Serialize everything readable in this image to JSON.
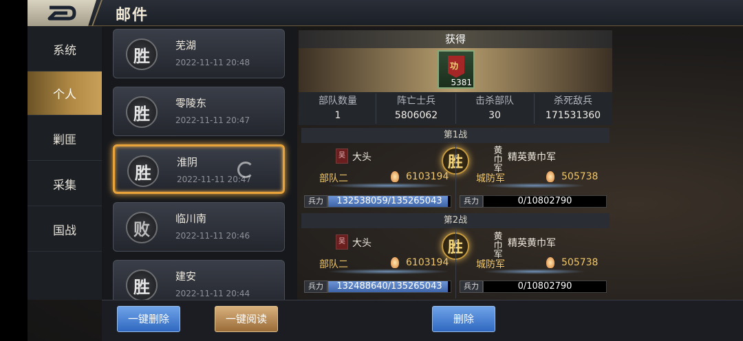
{
  "header": {
    "title": "邮件",
    "back_icon": "back-arrow-icon"
  },
  "sidebar": {
    "items": [
      {
        "label": "系统",
        "active": false
      },
      {
        "label": "个人",
        "active": true
      },
      {
        "label": "剿匪",
        "active": false
      },
      {
        "label": "采集",
        "active": false
      },
      {
        "label": "国战",
        "active": false
      }
    ]
  },
  "mails": [
    {
      "result": "胜",
      "name": "芜湖",
      "time": "2022-11-11  20:48",
      "selected": false
    },
    {
      "result": "胜",
      "name": "零陵东",
      "time": "2022-11-11  20:47",
      "selected": false
    },
    {
      "result": "胜",
      "name": "淮阴",
      "time": "2022-11-11  20:47",
      "selected": true
    },
    {
      "result": "败",
      "name": "临川南",
      "time": "2022-11-11  20:46",
      "selected": false
    },
    {
      "result": "胜",
      "name": "建安",
      "time": "2022-11-11  20:44",
      "selected": false
    }
  ],
  "detail": {
    "gain_title": "获得",
    "item": {
      "badge": "功",
      "count": "5381"
    },
    "stats": {
      "headers": [
        "部队数量",
        "阵亡士兵",
        "击杀部队",
        "杀死敌兵"
      ],
      "values": [
        "1",
        "5806062",
        "30",
        "171531360"
      ]
    },
    "battles": [
      {
        "title": "第1战",
        "left": {
          "gen": "吴",
          "name": "大头",
          "unit": "部队二",
          "power": "6103194",
          "hp_label": "兵力",
          "hp": "132538059/135265043",
          "hp_fraction": 0.98
        },
        "result": "胜",
        "right": {
          "gen": "黄巾军",
          "name": "精英黄巾军",
          "unit": "城防军",
          "power": "505738",
          "hp_label": "兵力",
          "hp": "0/10802790",
          "hp_fraction": 0
        }
      },
      {
        "title": "第2战",
        "left": {
          "gen": "吴",
          "name": "大头",
          "unit": "部队二",
          "power": "6103194",
          "hp_label": "兵力",
          "hp": "132488640/135265043",
          "hp_fraction": 0.98
        },
        "result": "胜",
        "right": {
          "gen": "黄巾军",
          "name": "精英黄巾军",
          "unit": "城防军",
          "power": "505738",
          "hp_label": "兵力",
          "hp": "0/10802790",
          "hp_fraction": 0
        }
      }
    ]
  },
  "bottom": {
    "delete_all": "一键删除",
    "read_all": "一键阅读",
    "delete": "删除"
  }
}
